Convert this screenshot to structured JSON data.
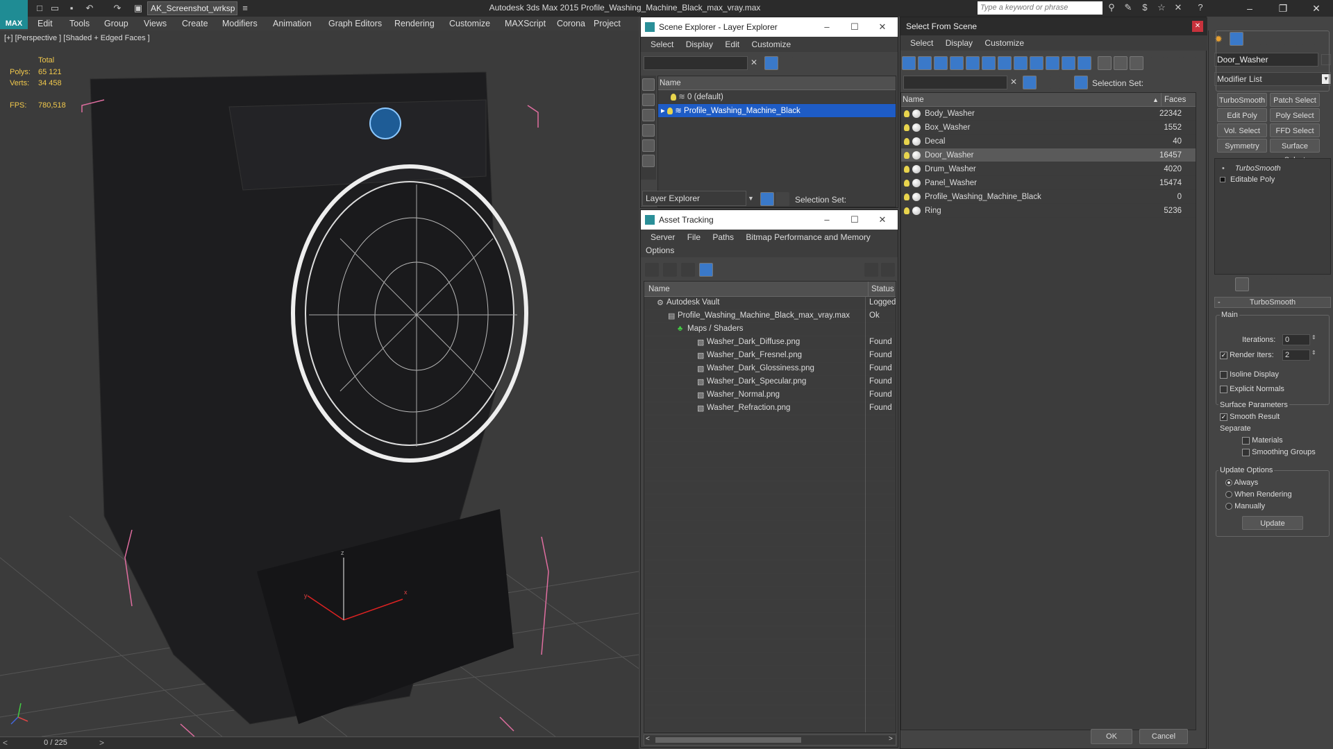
{
  "app": {
    "logo": "MAX",
    "workspace": "AK_Screenshot_wrksp",
    "title": "Autodesk 3ds Max  2015    Profile_Washing_Machine_Black_max_vray.max",
    "search_placeholder": "Type a keyword or phrase"
  },
  "menu": [
    "Edit",
    "Tools",
    "Group",
    "Views",
    "Create",
    "Modifiers",
    "Animation",
    "Graph Editors",
    "Rendering",
    "Customize",
    "MAXScript",
    "Corona",
    "Project Man"
  ],
  "viewport": {
    "label": "[+] [Perspective ] [Shaded + Edged Faces ]",
    "stats_total_label": "Total",
    "polys_label": "Polys:",
    "polys": "65 121",
    "verts_label": "Verts:",
    "verts": "34 458",
    "fps_label": "FPS:",
    "fps": "780,518",
    "axis_x": "x",
    "axis_y": "y",
    "axis_z": "z"
  },
  "timeline": {
    "value": "0 / 225"
  },
  "scene_explorer": {
    "title": "Scene Explorer - Layer Explorer",
    "menu": [
      "Select",
      "Display",
      "Edit",
      "Customize"
    ],
    "col_name": "Name",
    "rows": [
      "0 (default)",
      "Profile_Washing_Machine_Black"
    ],
    "footer_dropdown": "Layer Explorer",
    "selection_set": "Selection Set:"
  },
  "asset_tracking": {
    "title": "Asset Tracking",
    "menu": [
      "Server",
      "File",
      "Paths",
      "Bitmap Performance and Memory"
    ],
    "menu2": "Options",
    "col_name": "Name",
    "col_status": "Status",
    "rows": [
      {
        "name": "Autodesk Vault",
        "status": "Logged"
      },
      {
        "name": "Profile_Washing_Machine_Black_max_vray.max",
        "status": "Ok"
      },
      {
        "name": "Maps / Shaders",
        "status": ""
      },
      {
        "name": "Washer_Dark_Diffuse.png",
        "status": "Found"
      },
      {
        "name": "Washer_Dark_Fresnel.png",
        "status": "Found"
      },
      {
        "name": "Washer_Dark_Glossiness.png",
        "status": "Found"
      },
      {
        "name": "Washer_Dark_Specular.png",
        "status": "Found"
      },
      {
        "name": "Washer_Normal.png",
        "status": "Found"
      },
      {
        "name": "Washer_Refraction.png",
        "status": "Found"
      }
    ]
  },
  "select_from_scene": {
    "title": "Select From Scene",
    "menu": [
      "Select",
      "Display",
      "Customize"
    ],
    "selection_set": "Selection Set:",
    "col_name": "Name",
    "col_faces": "Faces",
    "rows": [
      {
        "name": "Body_Washer",
        "faces": "22342"
      },
      {
        "name": "Box_Washer",
        "faces": "1552"
      },
      {
        "name": "Decal",
        "faces": "40"
      },
      {
        "name": "Door_Washer",
        "faces": "16457"
      },
      {
        "name": "Drum_Washer",
        "faces": "4020"
      },
      {
        "name": "Panel_Washer",
        "faces": "15474"
      },
      {
        "name": "Profile_Washing_Machine_Black",
        "faces": "0"
      },
      {
        "name": "Ring",
        "faces": "5236"
      }
    ],
    "ok": "OK",
    "cancel": "Cancel"
  },
  "command_panel": {
    "object_name": "Door_Washer",
    "modifier_list": "Modifier List",
    "buttons": [
      "TurboSmooth",
      "Patch Select",
      "Edit Poly",
      "Poly Select",
      "Vol. Select",
      "FFD Select",
      "Symmetry",
      "Surface Select"
    ],
    "stack": [
      "TurboSmooth",
      "Editable Poly"
    ],
    "rollout_title": "TurboSmooth",
    "main": "Main",
    "iterations_label": "Iterations:",
    "iterations": "0",
    "render_iters_label": "Render Iters:",
    "render_iters": "2",
    "isoline": "Isoline Display",
    "explicit": "Explicit Normals",
    "surface_params": "Surface Parameters",
    "smooth_result": "Smooth Result",
    "separate": "Separate",
    "materials": "Materials",
    "smoothing_groups": "Smoothing Groups",
    "update_options": "Update Options",
    "always": "Always",
    "when_rendering": "When Rendering",
    "manually": "Manually",
    "update": "Update"
  }
}
